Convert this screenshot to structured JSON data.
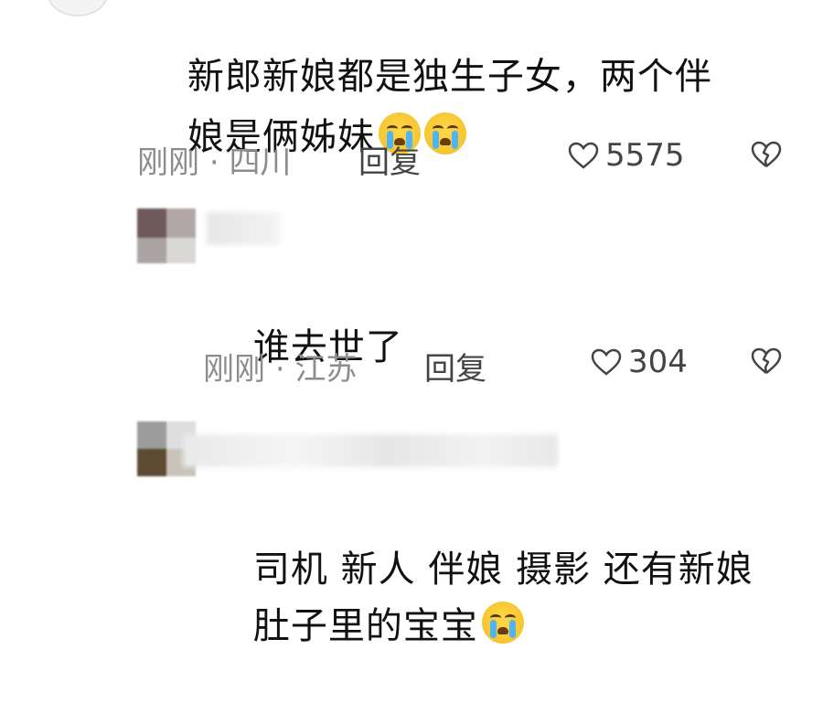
{
  "comments": [
    {
      "text_line1": "新郎新娘都是独生子女，两个伴",
      "text_line2": "娘是俩姊妹",
      "emoji_count": 2,
      "time": "刚刚",
      "separator": "·",
      "location": "四川",
      "reply_label": "回复",
      "likes": "5575"
    },
    {
      "text_line1": "谁去世了",
      "time": "刚刚",
      "separator": "·",
      "location": "江苏",
      "reply_label": "回复",
      "likes": "304"
    },
    {
      "text_line1": "司机 新人 伴娘 摄影 还有新娘",
      "text_line2": "肚子里的宝宝",
      "emoji_count": 1
    }
  ],
  "colors": {
    "meta": "#8c8c8c",
    "text": "#111111",
    "icon": "#444444"
  },
  "icons": {
    "like": "heart-outline-icon",
    "dislike": "broken-heart-icon",
    "emoji": "crying-face-emoji"
  }
}
